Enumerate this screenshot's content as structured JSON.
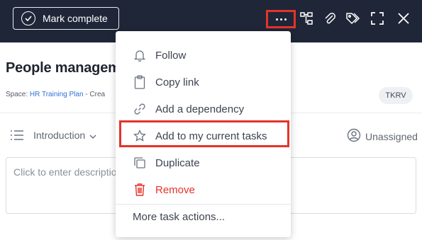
{
  "toolbar": {
    "mark_complete_label": "Mark complete",
    "icons": [
      "more-icon",
      "subtasks-icon",
      "attachment-icon",
      "tags-icon",
      "fullscreen-icon",
      "close-icon"
    ]
  },
  "task": {
    "title": "People manageme",
    "space_label": "Space: ",
    "space_name": "HR Training Plan",
    "created_label": " - Crea",
    "badge": "TKRV",
    "section": "Introduction",
    "assignee": "Unassigned",
    "description_placeholder": "Click to enter descriptio"
  },
  "menu": {
    "items": [
      {
        "label": "Follow",
        "icon": "bell-icon"
      },
      {
        "label": "Copy link",
        "icon": "clipboard-icon"
      },
      {
        "label": "Add a dependency",
        "icon": "link-icon"
      },
      {
        "label": "Add to my current tasks",
        "icon": "star-icon"
      },
      {
        "label": "Duplicate",
        "icon": "duplicate-icon"
      },
      {
        "label": "Remove",
        "icon": "trash-icon"
      }
    ],
    "more_actions": "More task actions..."
  },
  "colors": {
    "toolbar_bg": "#1f2638",
    "highlight": "#e5332a",
    "link": "#2f6fd6",
    "danger": "#e5332a"
  }
}
